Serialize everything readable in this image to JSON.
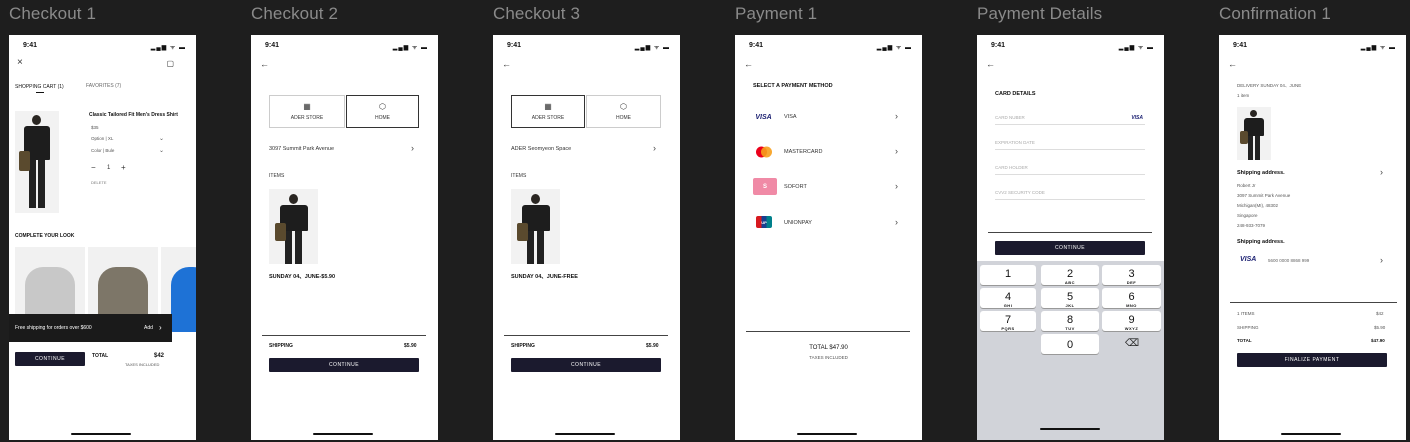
{
  "frames": [
    {
      "title": "Checkout 1"
    },
    {
      "title": "Checkout 2"
    },
    {
      "title": "Checkout 3"
    },
    {
      "title": "Payment 1"
    },
    {
      "title": "Payment Details"
    },
    {
      "title": "Confirmation 1"
    }
  ],
  "status": {
    "time": "9:41",
    "icons": "▂▄▆ ᯤ ▬"
  },
  "icons": {
    "back": "←",
    "close": "×",
    "chat": "▢",
    "chevron": "›",
    "backspace": "⌫"
  },
  "checkout1": {
    "tab_cart": "SHOPPING CART (1)",
    "tab_favorites": "FAVORITES (7)",
    "product_name": "Classic Tailored Fit Men's Dress Shirt",
    "price": "$35",
    "option": "Option | XL",
    "color": "Color | Bule",
    "minus": "−",
    "qty": "1",
    "plus": "+",
    "delete": "DELETE",
    "complete_look": "COMPLETE YOUR LOOK",
    "toast_text": "Free shipping for orders over $600",
    "toast_action": "Add",
    "continue": "CONTINUE",
    "total_label": "TOTAL",
    "total_value": "$42",
    "taxes": "TAXES INCLUDED"
  },
  "checkout2": {
    "store_label": "ADER STORE",
    "home_label": "HOME",
    "address": "3097 Summit Park Avenue",
    "items": "ITEMS",
    "delivery": "SUNDAY 04、JUNE-$5.90",
    "shipping_label": "SHIPPING",
    "shipping_value": "$5.90",
    "continue": "CONTINUE"
  },
  "checkout3": {
    "store_label": "ADER STORE",
    "home_label": "HOME",
    "address": "ADER Seomyeon Space",
    "items": "ITEMS",
    "delivery": "SUNDAY 04、JUNE-FREE",
    "shipping_label": "SHIPPING",
    "shipping_value": "$5.90",
    "continue": "CONTINUE"
  },
  "payment1": {
    "heading": "SELECT A PAYMENT METHOD",
    "methods": [
      {
        "label": "VISA",
        "logo": "VISA",
        "color": "#1a1f71"
      },
      {
        "label": "MASTERCARD",
        "logo": "",
        "color": "#eb001b"
      },
      {
        "label": "SOFORT",
        "logo": "S",
        "color": "#f08aa6"
      },
      {
        "label": "UNIONPAY",
        "logo": "UP",
        "color": "#d7191f"
      }
    ],
    "total": "TOTAL $47.90",
    "taxes": "TAXES INCLUDED"
  },
  "payment_details": {
    "heading": "CARD DETAILS",
    "card_number": "CARD NUBER",
    "card_brand": "VISA",
    "expiration": "EXPIRATION DATE",
    "holder": "CARD HOLDER",
    "cvv": "CVV2 SECURITY CODE",
    "continue": "CONTINUE",
    "keys": [
      {
        "n": "1",
        "l": ""
      },
      {
        "n": "2",
        "l": "ABC"
      },
      {
        "n": "3",
        "l": "DEF"
      },
      {
        "n": "4",
        "l": "GHI"
      },
      {
        "n": "5",
        "l": "JKL"
      },
      {
        "n": "6",
        "l": "MNO"
      },
      {
        "n": "7",
        "l": "PQRS"
      },
      {
        "n": "8",
        "l": "TUV"
      },
      {
        "n": "9",
        "l": "WXYZ"
      },
      {
        "n": "0",
        "l": ""
      }
    ]
  },
  "confirmation": {
    "delivery": "DELIVERY SUNDAY 04、JUNE",
    "item_count": "1 item",
    "shipping_addr_title": "Shipping address.",
    "name": "Robert Jr",
    "street": "3097 Summit Park Avenue",
    "city": "Michigan(MI), 48302",
    "country": "Singapore",
    "phone": "248-933-7079",
    "payment_title": "Shipping address.",
    "card_brand": "VISA",
    "card_number": "5600 0000 8868 999",
    "items_label": "1 ITEMS",
    "items_value": "$42",
    "shipping_label": "SHIPPING",
    "shipping_value": "$5.90",
    "total_label": "TOTAL",
    "total_value": "$47.90",
    "finalize": "FINALIZE PAYMENT"
  }
}
